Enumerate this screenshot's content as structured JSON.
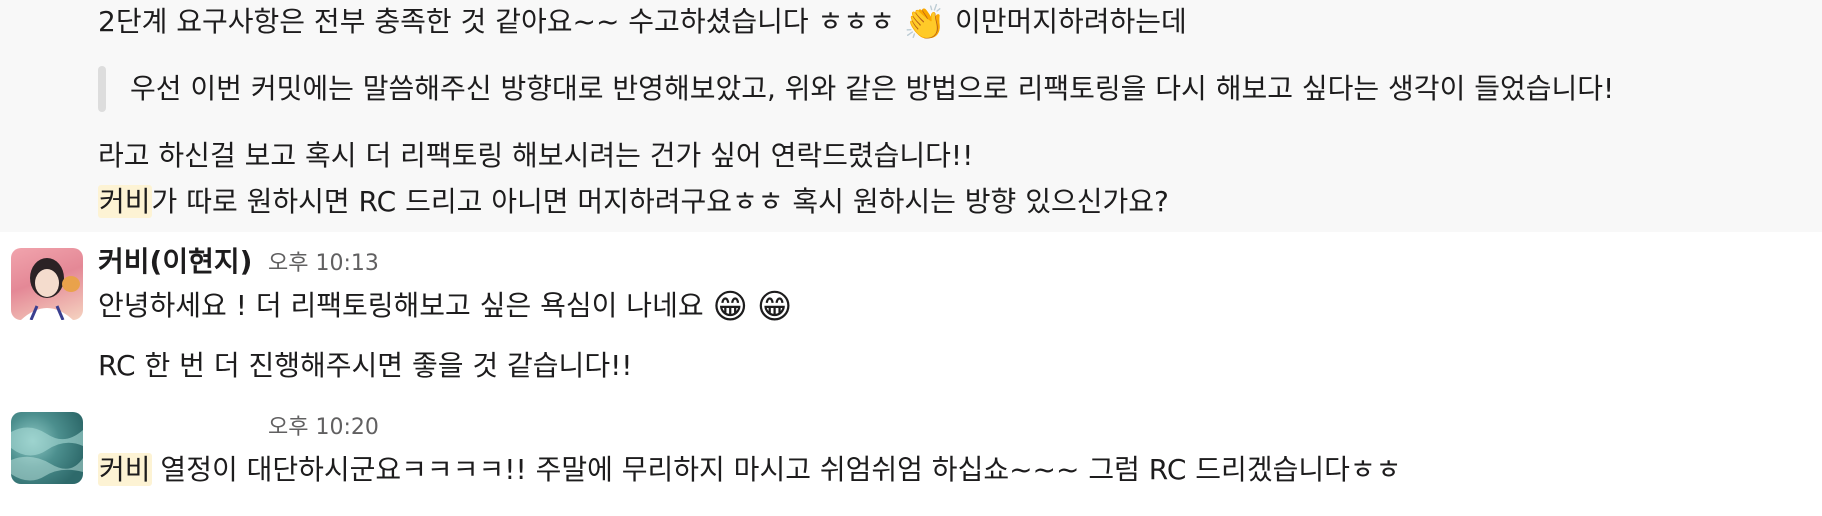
{
  "messages": [
    {
      "line1_prefix": "2단계 요구사항은 전부 충족한 것 같아요~~ 수고하셨습니다 ㅎㅎㅎ ",
      "line1_emoji": "👏",
      "line1_suffix": " 이만머지하려하는데",
      "quote": "우선 이번 커밋에는 말씀해주신 방향대로 반영해보았고, 위와 같은 방법으로 리팩토링을 다시 해보고 싶다는 생각이 들었습니다!",
      "line2": "라고 하신걸 보고 혹시 더 리팩토링 해보시려는 건가 싶어 연락드렸습니다!!",
      "line3_mention": "커비",
      "line3_rest": "가 따로 원하시면 RC 드리고 아니면 머지하려구요ㅎㅎ 혹시 원하시는 방향 있으신가요?"
    },
    {
      "sender": "커비(이현지)",
      "time": "오후 10:13",
      "line1_text": "안녕하세요     ! 더 리팩토링해보고 싶은 욕심이 나네요 ",
      "line1_emoji1": "😁",
      "line1_emoji2": "😁",
      "line2": "RC 한 번 더 진행해주시면 좋을 것 같습니다!!"
    },
    {
      "time": "오후 10:20",
      "line1_mention": "커비",
      "line1_rest": " 열정이 대단하시군요ㅋㅋㅋㅋ!! 주말에 무리하지 마시고 쉬엄쉬엄 하십쇼~~~ 그럼 RC 드리겠습니다ㅎㅎ"
    }
  ]
}
